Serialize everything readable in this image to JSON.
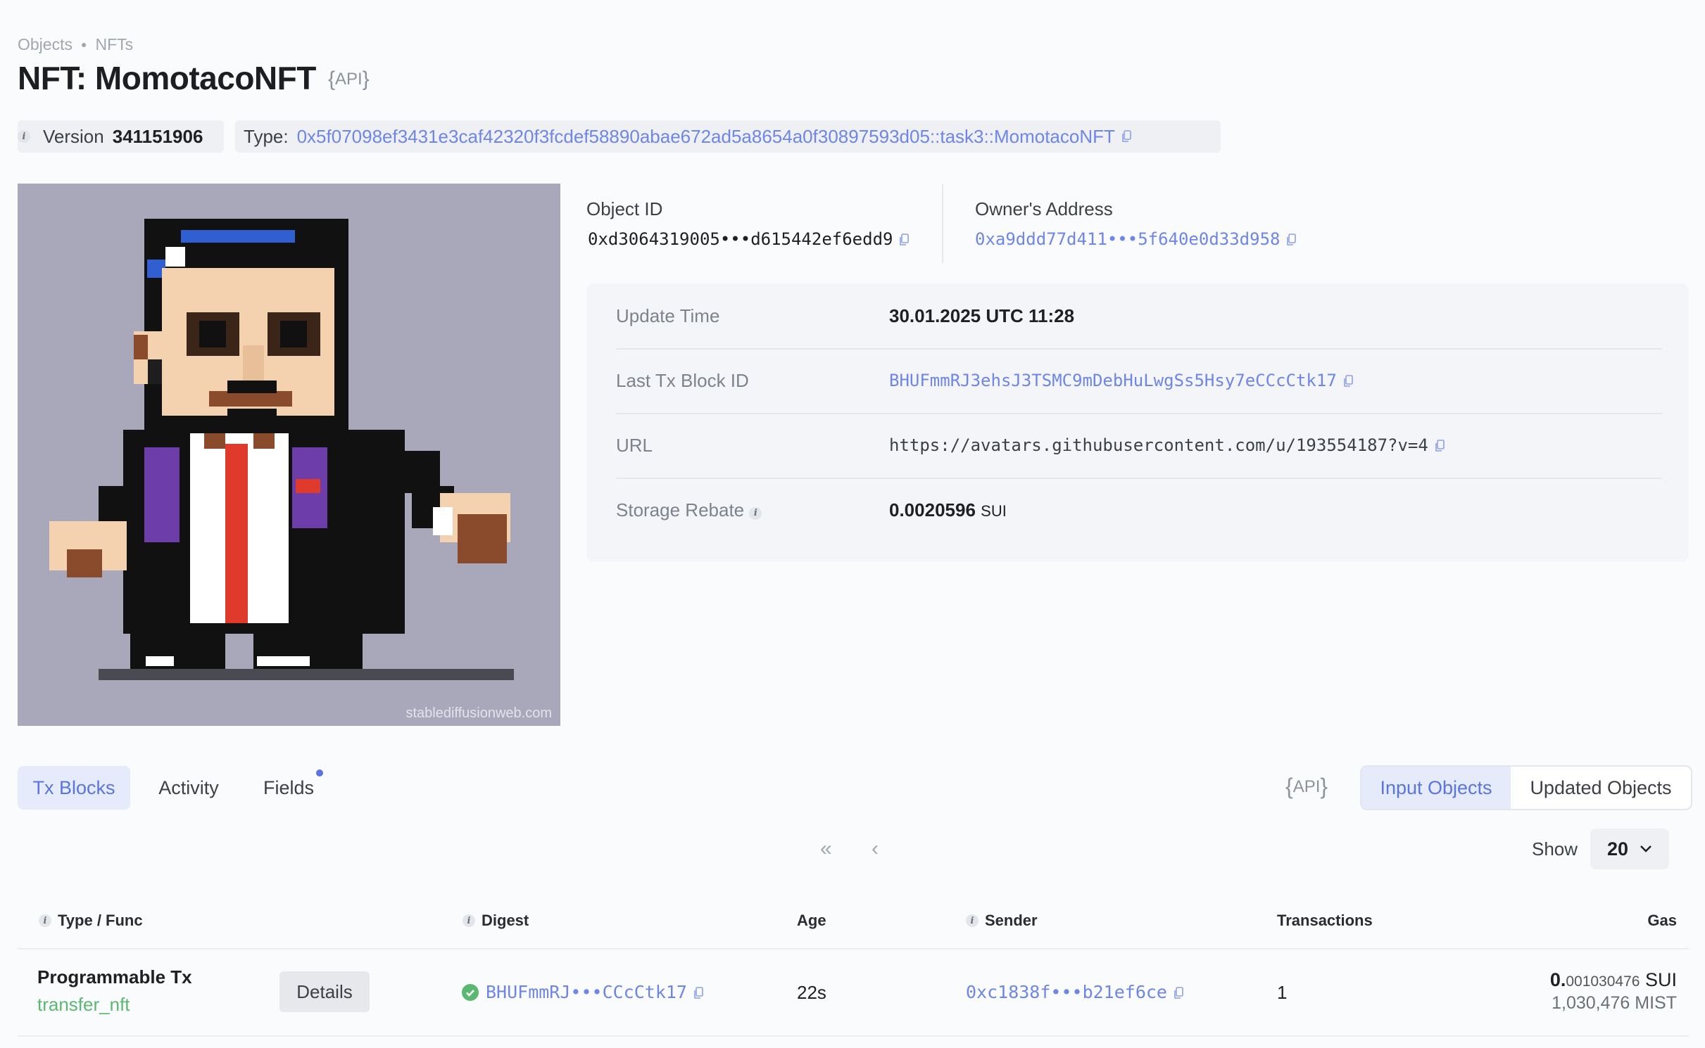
{
  "breadcrumb": {
    "items": [
      "Objects",
      "NFTs"
    ]
  },
  "page": {
    "title": "NFT: MomotacoNFT",
    "api_label": "API"
  },
  "version": {
    "label": "Version",
    "value": "341151906"
  },
  "type": {
    "label": "Type:",
    "value": "0x5f07098ef3431e3caf42320f3fcdef58890abae672ad5a8654a0f30897593d05::task3::MomotacoNFT"
  },
  "nft_image": {
    "watermark": "stablediffusionweb.com",
    "background": "#a9a7ba"
  },
  "object": {
    "id_label": "Object ID",
    "id_value": "0xd3064319005•••d615442ef6edd9",
    "owner_label": "Owner's Address",
    "owner_value": "0xa9ddd77d411•••5f640e0d33d958"
  },
  "properties": {
    "update_time_label": "Update Time",
    "update_time_value": "30.01.2025 UTC 11:28",
    "last_tx_label": "Last Tx Block ID",
    "last_tx_value": "BHUFmmRJ3ehsJ3TSMC9mDebHuLwgSs5Hsy7eCCcCtk17",
    "url_label": "URL",
    "url_value": "https://avatars.githubusercontent.com/u/193554187?v=4",
    "storage_rebate_label": "Storage Rebate",
    "storage_rebate_value": "0.0020596",
    "storage_rebate_unit": "SUI"
  },
  "tabs": {
    "tx_blocks": "Tx Blocks",
    "activity": "Activity",
    "fields": "Fields",
    "api_label": "API"
  },
  "toggle": {
    "input_objects": "Input Objects",
    "updated_objects": "Updated Objects"
  },
  "pagination": {
    "show_label": "Show",
    "page_size": "20"
  },
  "table": {
    "headers": {
      "type_func": "Type / Func",
      "digest": "Digest",
      "age": "Age",
      "sender": "Sender",
      "transactions": "Transactions",
      "gas": "Gas"
    },
    "rows": [
      {
        "type": "Programmable Tx",
        "func": "transfer_nft",
        "details_label": "Details",
        "digest": "BHUFmmRJ•••CCcCtk17",
        "age": "22s",
        "sender": "0xc1838f•••b21ef6ce",
        "transactions": "1",
        "gas_sui_whole": "0.",
        "gas_sui_fraction": "001030476",
        "gas_sui_unit": "SUI",
        "gas_mist": "1,030,476 MIST"
      }
    ]
  },
  "colors": {
    "accent": "#5a74e0",
    "link": "#6f86e8",
    "success": "#5bb872"
  },
  "icons": [
    "info-icon",
    "copy-icon",
    "chevron-double-left-icon",
    "chevron-left-icon",
    "chevron-down-icon",
    "success-check-icon"
  ]
}
